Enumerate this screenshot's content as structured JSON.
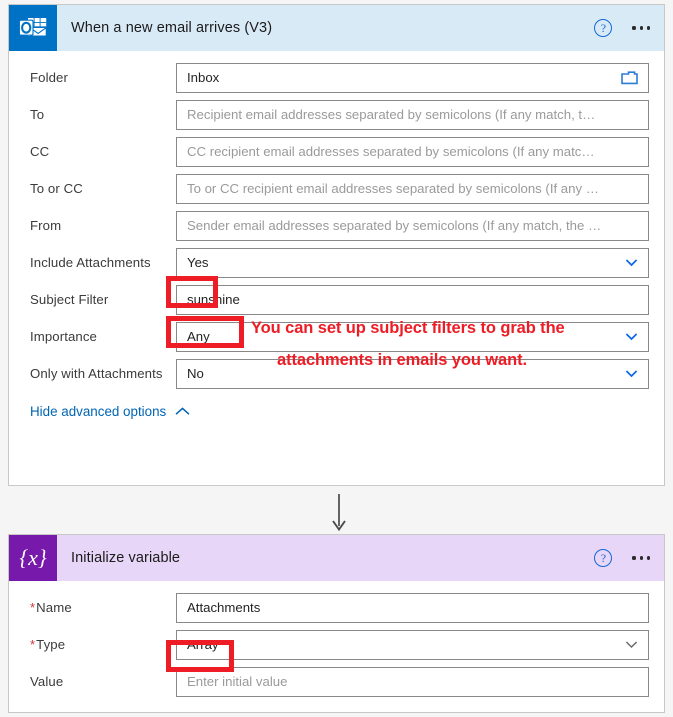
{
  "trigger_card": {
    "icon_name": "outlook-icon",
    "title": "When a new email arrives (V3)",
    "help_label": "?",
    "more_label": "•••",
    "fields": [
      {
        "label": "Folder",
        "value": "Inbox",
        "is_placeholder": false,
        "control": "folder-picker"
      },
      {
        "label": "To",
        "value": "Recipient email addresses separated by semicolons (If any match, t…",
        "is_placeholder": true,
        "control": "text"
      },
      {
        "label": "CC",
        "value": "CC recipient email addresses separated by semicolons (If any matc…",
        "is_placeholder": true,
        "control": "text"
      },
      {
        "label": "To or CC",
        "value": "To or CC recipient email addresses separated by semicolons (If any …",
        "is_placeholder": true,
        "control": "text"
      },
      {
        "label": "From",
        "value": "Sender email addresses separated by semicolons (If any match, the …",
        "is_placeholder": true,
        "control": "text"
      },
      {
        "label": "Include Attachments",
        "value": "Yes",
        "is_placeholder": false,
        "control": "dropdown"
      },
      {
        "label": "Subject Filter",
        "value": "sunshine",
        "is_placeholder": false,
        "control": "text"
      },
      {
        "label": "Importance",
        "value": "Any",
        "is_placeholder": false,
        "control": "dropdown"
      },
      {
        "label": "Only with Attachments",
        "value": "No",
        "is_placeholder": false,
        "control": "dropdown"
      }
    ],
    "advanced_options_label": "Hide advanced options"
  },
  "annotation": {
    "line1": "You can set up subject filters to grab the",
    "line2": "attachments in emails you want.",
    "color": "#ee1c25"
  },
  "action_card": {
    "icon_name": "variable-icon",
    "icon_glyph": "{x}",
    "title": "Initialize variable",
    "help_label": "?",
    "more_label": "•••",
    "fields": [
      {
        "label": "Name",
        "required": true,
        "value": "Attachments",
        "is_placeholder": false,
        "control": "text"
      },
      {
        "label": "Type",
        "required": true,
        "value": "Array",
        "is_placeholder": false,
        "control": "dropdown"
      },
      {
        "label": "Value",
        "required": false,
        "value": "Enter initial value",
        "is_placeholder": true,
        "control": "text"
      }
    ]
  },
  "colors": {
    "outlook_brand": "#0072c6",
    "outlook_header": "#d9eaf7",
    "variable_brand": "#7719aa",
    "variable_header": "#e7d6f7",
    "link_blue": "#0065b3",
    "highlight_red": "#ee1c25",
    "required_red": "#d13438"
  }
}
